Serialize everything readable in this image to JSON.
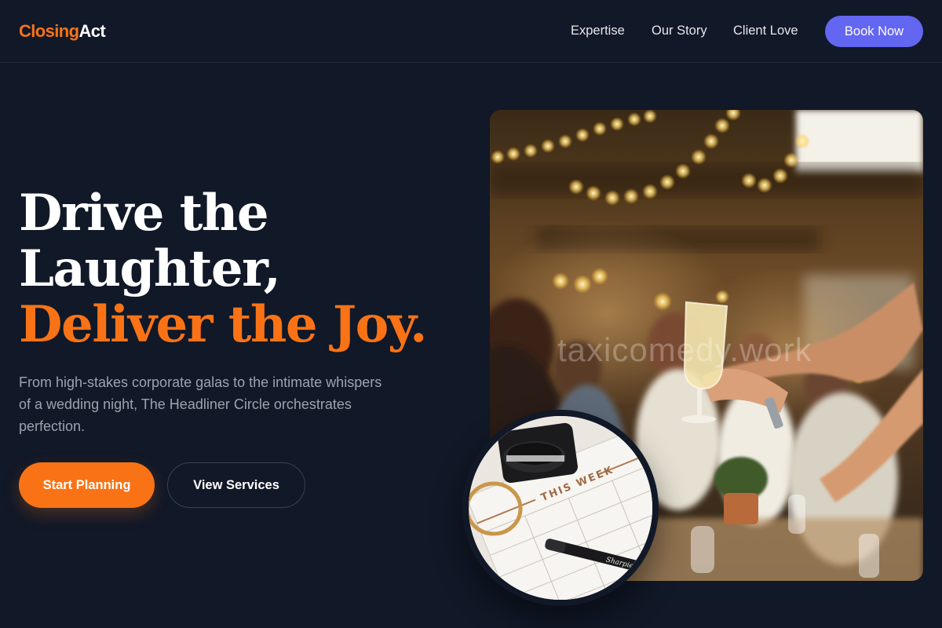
{
  "header": {
    "logo_part1": "Closing",
    "logo_part2": "Act",
    "nav": [
      "Expertise",
      "Our Story",
      "Client Love"
    ],
    "cta": "Book Now"
  },
  "hero": {
    "title_line1": "Drive the",
    "title_line2": "Laughter,",
    "title_line3": "Deliver the Joy.",
    "subtitle": "From high-stakes corporate galas to the intimate whispers of a wedding night, The Headliner Circle orchestrates perfection.",
    "primary_button": "Start Planning",
    "secondary_button": "View Services"
  },
  "photo": {
    "watermark": "taxicomedy.work"
  },
  "inset": {
    "planner_heading": "THIS WEEK",
    "pen_brand": "Sharpie"
  },
  "colors": {
    "background": "#111827",
    "accent_orange": "#f97316",
    "accent_indigo": "#6366f1",
    "muted_text": "#9ca3af"
  }
}
